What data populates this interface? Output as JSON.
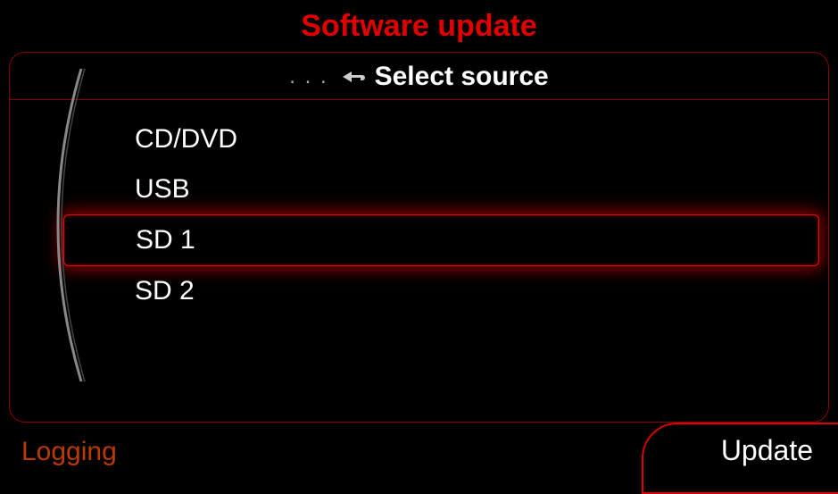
{
  "title": "Software update",
  "subheader": {
    "dots": ". . .",
    "text": "Select source"
  },
  "sources": [
    {
      "label": "CD/DVD",
      "selected": false
    },
    {
      "label": "USB",
      "selected": false
    },
    {
      "label": "SD 1",
      "selected": true
    },
    {
      "label": "SD 2",
      "selected": false
    }
  ],
  "footer": {
    "left": "Logging",
    "right": "Update"
  }
}
